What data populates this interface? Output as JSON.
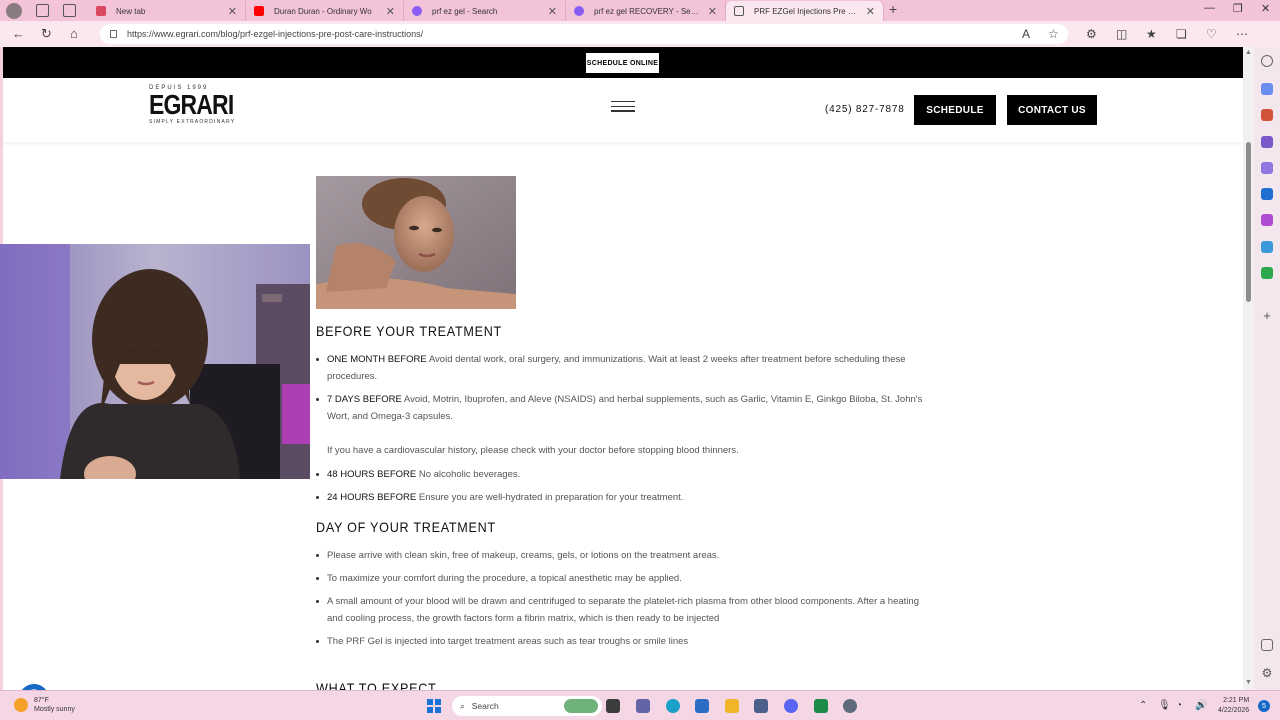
{
  "browser": {
    "tabs": [
      {
        "label": "New tab",
        "favicon_color": "#d9485f"
      },
      {
        "label": "Duran Duran - Ordinary Wo",
        "favicon_color": "#ff0000"
      },
      {
        "label": "prf ez gel - Search",
        "favicon_color": "#8a5cf6"
      },
      {
        "label": "prf ez gel RECOVERY - Search",
        "favicon_color": "#8a5cf6"
      },
      {
        "label": "PRF EZGel Injections Pre + Post",
        "favicon_color": "#555555"
      }
    ],
    "url": "https://www.egrari.com/blog/prf-ezgel-injections-pre-post-care-instructions/"
  },
  "site": {
    "top_button": "SCHEDULE ONLINE",
    "logo": {
      "since": "DEPUIS 1999",
      "name": "EGRARI",
      "tagline": "SIMPLY EXTRAORDINARY"
    },
    "phone": "(425) 827-7878",
    "schedule_button": "SCHEDULE",
    "contact_button": "CONTACT US"
  },
  "article": {
    "before": {
      "heading": "BEFORE YOUR TREATMENT",
      "items": [
        {
          "label": "ONE MONTH BEFORE",
          "text": " Avoid dental work, oral surgery, and immunizations. Wait at least 2 weeks after treatment before scheduling these procedures."
        },
        {
          "label": "7 DAYS BEFORE",
          "text": " Avoid, Motrin, Ibuprofen, and Aleve (NSAIDS) and herbal supplements, such as Garlic, Vitamin E, Ginkgo Biloba, St. John's Wort, and Omega-3 capsules."
        }
      ],
      "note": "If you have a cardiovascular history, please check with your doctor before stopping blood thinners.",
      "items2": [
        {
          "label": "48 HOURS BEFORE",
          "text": " No alcoholic beverages."
        },
        {
          "label": "24 HOURS BEFORE",
          "text": " Ensure you are well-hydrated in preparation for your treatment."
        }
      ]
    },
    "day": {
      "heading": "DAY OF YOUR TREATMENT",
      "items": [
        "Please arrive with clean skin, free of makeup, creams, gels, or lotions on the treatment areas.",
        "To maximize your comfort during the procedure, a topical anesthetic may be applied.",
        "A small amount of your blood will be drawn and centrifuged to separate the platelet-rich plasma from other blood components. After a heating and cooling process, the growth factors form a fibrin matrix, which is then ready to be injected",
        "The PRF Gel is injected into target treatment areas such as tear troughs or smile lines"
      ]
    },
    "expect_heading": "WHAT TO EXPECT"
  },
  "taskbar": {
    "temp": "87°F",
    "weather": "Mostly sunny",
    "search": "Search",
    "time": "2:21 PM",
    "date": "4/22/2026",
    "notifications": "5"
  }
}
